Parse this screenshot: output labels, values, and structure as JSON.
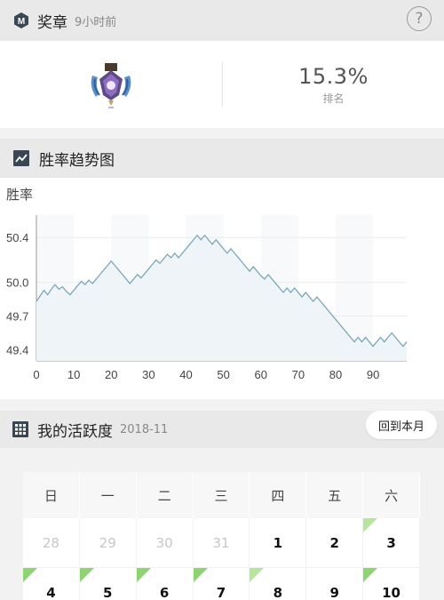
{
  "header": {
    "title": "奖章",
    "time": "9小时前",
    "help": "?"
  },
  "medal": {
    "rank_value": "15.3%",
    "rank_label": "排名"
  },
  "trend": {
    "title": "胜率趋势图",
    "chart_data": {
      "type": "line",
      "title": "",
      "ylabel": "胜率",
      "xlabel": "",
      "xlim": [
        0,
        99
      ],
      "ylim": [
        49.3,
        50.6
      ],
      "x_ticks": [
        0,
        10,
        20,
        30,
        40,
        50,
        60,
        70,
        80,
        90
      ],
      "y_ticks": [
        49.4,
        49.7,
        50.0,
        50.4
      ],
      "grid": "horizontal",
      "series": [
        {
          "values": [
            49.83,
            49.88,
            49.93,
            49.89,
            49.94,
            49.98,
            49.94,
            49.96,
            49.92,
            49.89,
            49.93,
            49.97,
            50.01,
            49.98,
            50.02,
            49.99,
            50.03,
            50.07,
            50.11,
            50.15,
            50.19,
            50.15,
            50.11,
            50.07,
            50.03,
            49.99,
            50.03,
            50.07,
            50.04,
            50.08,
            50.12,
            50.16,
            50.2,
            50.17,
            50.21,
            50.25,
            50.22,
            50.26,
            50.22,
            50.26,
            50.3,
            50.34,
            50.38,
            50.42,
            50.38,
            50.42,
            50.38,
            50.34,
            50.38,
            50.34,
            50.3,
            50.26,
            50.3,
            50.26,
            50.22,
            50.18,
            50.14,
            50.1,
            50.14,
            50.1,
            50.06,
            50.03,
            50.07,
            50.03,
            49.99,
            49.95,
            49.91,
            49.95,
            49.91,
            49.95,
            49.91,
            49.87,
            49.91,
            49.87,
            49.83,
            49.87,
            49.83,
            49.79,
            49.75,
            49.71,
            49.67,
            49.63,
            49.59,
            49.55,
            49.51,
            49.47,
            49.51,
            49.47,
            49.51,
            49.47,
            49.43,
            49.47,
            49.51,
            49.47,
            49.51,
            49.55,
            49.51,
            49.47,
            49.43,
            49.47
          ],
          "color": "#7aa8b8"
        }
      ]
    }
  },
  "activity": {
    "title": "我的活跃度",
    "month": "2018-11",
    "back_button": "回到本月",
    "weekdays": [
      "日",
      "一",
      "二",
      "三",
      "四",
      "五",
      "六"
    ],
    "rows": [
      [
        {
          "d": "28",
          "muted": true
        },
        {
          "d": "29",
          "muted": true
        },
        {
          "d": "30",
          "muted": true
        },
        {
          "d": "31",
          "muted": true
        },
        {
          "d": "1"
        },
        {
          "d": "2"
        },
        {
          "d": "3",
          "mark": "light"
        }
      ],
      [
        {
          "d": "4",
          "mark": "dark"
        },
        {
          "d": "5",
          "mark": "dark"
        },
        {
          "d": "6",
          "mark": "dark"
        },
        {
          "d": "7",
          "mark": "dark"
        },
        {
          "d": "8",
          "mark": "light"
        },
        {
          "d": "9"
        },
        {
          "d": "10",
          "mark": "dark"
        }
      ]
    ]
  }
}
